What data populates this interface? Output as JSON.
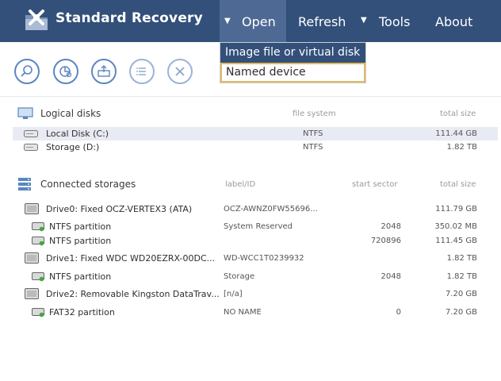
{
  "app": {
    "title": "Standard Recovery"
  },
  "menu": {
    "open": "Open",
    "refresh": "Refresh",
    "tools": "Tools",
    "about": "About",
    "open_dropdown": [
      "Image file or virtual disk",
      "Named device"
    ]
  },
  "toolbar": {
    "buttons": [
      "search-icon",
      "scan-icon",
      "open-icon",
      "list-icon",
      "close-icon"
    ]
  },
  "logical": {
    "title": "Logical disks",
    "col_fs": "file system",
    "col_size": "total size",
    "rows": [
      {
        "name": "Local Disk (C:)",
        "fs": "NTFS",
        "size": "111.44 GB"
      },
      {
        "name": "Storage (D:)",
        "fs": "NTFS",
        "size": "1.82 TB"
      }
    ]
  },
  "storages": {
    "title": "Connected storages",
    "col_label": "label/ID",
    "col_start": "start sector",
    "col_size": "total size",
    "rows": [
      {
        "name": "Drive0: Fixed OCZ-VERTEX3 (ATA)",
        "label": "OCZ-AWNZ0FW55696...",
        "start": "",
        "size": "111.79 GB"
      },
      {
        "name": "NTFS partition",
        "label": "System Reserved",
        "start": "2048",
        "size": "350.02 MB"
      },
      {
        "name": "NTFS partition",
        "label": "",
        "start": "720896",
        "size": "111.45 GB"
      },
      {
        "name": "Drive1: Fixed WDC WD20EZRX-00DC...",
        "label": "WD-WCC1T0239932",
        "start": "",
        "size": "1.82 TB"
      },
      {
        "name": "NTFS partition",
        "label": "Storage",
        "start": "2048",
        "size": "1.82 TB"
      },
      {
        "name": "Drive2: Removable Kingston DataTrav...",
        "label": "[n/a]",
        "start": "",
        "size": "7.20 GB"
      },
      {
        "name": "FAT32 partition",
        "label": "NO NAME",
        "start": "0",
        "size": "7.20 GB"
      }
    ]
  },
  "colors": {
    "bar": "#33507a",
    "accent": "#5a86c0",
    "focus": "#e2b960"
  }
}
